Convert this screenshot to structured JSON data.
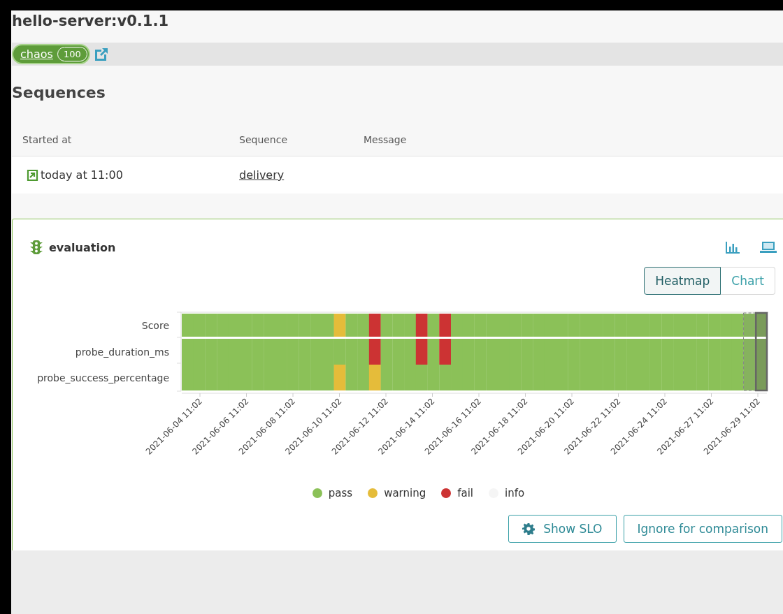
{
  "title": "hello-server:v0.1.1",
  "stage_badge": {
    "label": "chaos",
    "count": "100"
  },
  "sequences": {
    "heading": "Sequences",
    "columns": [
      "Started at",
      "Sequence",
      "Message"
    ],
    "rows": [
      {
        "started": "today at 11:00",
        "sequence": "delivery"
      }
    ]
  },
  "evaluation": {
    "title": "evaluation",
    "view_toggle": [
      {
        "label": "Heatmap",
        "selected": true
      },
      {
        "label": "Chart",
        "selected": false
      }
    ],
    "heatmap": {
      "rows": [
        "Score",
        "probe_duration_ms",
        "probe_success_percentage"
      ],
      "xticks": [
        "2021-06-04 11:02",
        "2021-06-06 11:02",
        "2021-06-08 11:02",
        "2021-06-10 11:02",
        "2021-06-12 11:02",
        "2021-06-14 11:02",
        "2021-06-16 11:02",
        "2021-06-18 11:02",
        "2021-06-20 11:02",
        "2021-06-22 11:02",
        "2021-06-24 11:02",
        "2021-06-27 11:02",
        "2021-06-29 11:02"
      ],
      "columns": [
        {
          "cells": [
            {
              "color": "#8bc158"
            },
            {
              "color": "#8bc158"
            },
            {
              "color": "#8bc158"
            }
          ],
          "selected": false,
          "compared": false
        },
        {
          "cells": [
            {
              "color": "#8bc158"
            },
            {
              "color": "#8bc158"
            },
            {
              "color": "#8bc158"
            }
          ],
          "selected": false,
          "compared": false
        },
        {
          "cells": [
            {
              "color": "#8bc158"
            },
            {
              "color": "#8bc158"
            },
            {
              "color": "#8bc158"
            }
          ],
          "selected": false,
          "compared": false
        },
        {
          "cells": [
            {
              "color": "#8bc158"
            },
            {
              "color": "#8bc158"
            },
            {
              "color": "#8bc158"
            }
          ],
          "selected": false,
          "compared": false
        },
        {
          "cells": [
            {
              "color": "#8bc158"
            },
            {
              "color": "#8bc158"
            },
            {
              "color": "#8bc158"
            }
          ],
          "selected": false,
          "compared": false
        },
        {
          "cells": [
            {
              "color": "#8bc158"
            },
            {
              "color": "#8bc158"
            },
            {
              "color": "#8bc158"
            }
          ],
          "selected": false,
          "compared": false
        },
        {
          "cells": [
            {
              "color": "#8bc158"
            },
            {
              "color": "#8bc158"
            },
            {
              "color": "#8bc158"
            }
          ],
          "selected": false,
          "compared": false
        },
        {
          "cells": [
            {
              "color": "#8bc158"
            },
            {
              "color": "#8bc158"
            },
            {
              "color": "#8bc158"
            }
          ],
          "selected": false,
          "compared": false
        },
        {
          "cells": [
            {
              "color": "#8bc158"
            },
            {
              "color": "#8bc158"
            },
            {
              "color": "#8bc158"
            }
          ],
          "selected": false,
          "compared": false
        },
        {
          "cells": [
            {
              "color": "#8bc158"
            },
            {
              "color": "#8bc158"
            },
            {
              "color": "#8bc158"
            }
          ],
          "selected": false,
          "compared": false
        },
        {
          "cells": [
            {
              "color": "#8bc158"
            },
            {
              "color": "#8bc158"
            },
            {
              "color": "#8bc158"
            }
          ],
          "selected": false,
          "compared": false
        },
        {
          "cells": [
            {
              "color": "#8bc158"
            },
            {
              "color": "#8bc158"
            },
            {
              "color": "#8bc158"
            }
          ],
          "selected": false,
          "compared": false
        },
        {
          "cells": [
            {
              "color": "#8bc158"
            },
            {
              "color": "#8bc158"
            },
            {
              "color": "#8bc158"
            }
          ],
          "selected": false,
          "compared": false
        },
        {
          "cells": [
            {
              "color": "#e5bc3a"
            },
            {
              "color": "#8bc158"
            },
            {
              "color": "#e5bc3a"
            }
          ],
          "selected": false,
          "compared": false
        },
        {
          "cells": [
            {
              "color": "#8bc158"
            },
            {
              "color": "#8bc158"
            },
            {
              "color": "#8bc158"
            }
          ],
          "selected": false,
          "compared": false
        },
        {
          "cells": [
            {
              "color": "#8bc158"
            },
            {
              "color": "#8bc158"
            },
            {
              "color": "#8bc158"
            }
          ],
          "selected": false,
          "compared": false
        },
        {
          "cells": [
            {
              "color": "#cc3333"
            },
            {
              "color": "#cc3333"
            },
            {
              "color": "#e5bc3a"
            }
          ],
          "selected": false,
          "compared": false
        },
        {
          "cells": [
            {
              "color": "#8bc158"
            },
            {
              "color": "#8bc158"
            },
            {
              "color": "#8bc158"
            }
          ],
          "selected": false,
          "compared": false
        },
        {
          "cells": [
            {
              "color": "#8bc158"
            },
            {
              "color": "#8bc158"
            },
            {
              "color": "#8bc158"
            }
          ],
          "selected": false,
          "compared": false
        },
        {
          "cells": [
            {
              "color": "#8bc158"
            },
            {
              "color": "#8bc158"
            },
            {
              "color": "#8bc158"
            }
          ],
          "selected": false,
          "compared": false
        },
        {
          "cells": [
            {
              "color": "#cc3333"
            },
            {
              "color": "#cc3333"
            },
            {
              "color": "#8bc158"
            }
          ],
          "selected": false,
          "compared": false
        },
        {
          "cells": [
            {
              "color": "#8bc158"
            },
            {
              "color": "#8bc158"
            },
            {
              "color": "#8bc158"
            }
          ],
          "selected": false,
          "compared": false
        },
        {
          "cells": [
            {
              "color": "#cc3333"
            },
            {
              "color": "#cc3333"
            },
            {
              "color": "#8bc158"
            }
          ],
          "selected": false,
          "compared": false
        },
        {
          "cells": [
            {
              "color": "#8bc158"
            },
            {
              "color": "#8bc158"
            },
            {
              "color": "#8bc158"
            }
          ],
          "selected": false,
          "compared": false
        },
        {
          "cells": [
            {
              "color": "#8bc158"
            },
            {
              "color": "#8bc158"
            },
            {
              "color": "#8bc158"
            }
          ],
          "selected": false,
          "compared": false
        },
        {
          "cells": [
            {
              "color": "#8bc158"
            },
            {
              "color": "#8bc158"
            },
            {
              "color": "#8bc158"
            }
          ],
          "selected": false,
          "compared": false
        },
        {
          "cells": [
            {
              "color": "#8bc158"
            },
            {
              "color": "#8bc158"
            },
            {
              "color": "#8bc158"
            }
          ],
          "selected": false,
          "compared": false
        },
        {
          "cells": [
            {
              "color": "#8bc158"
            },
            {
              "color": "#8bc158"
            },
            {
              "color": "#8bc158"
            }
          ],
          "selected": false,
          "compared": false
        },
        {
          "cells": [
            {
              "color": "#8bc158"
            },
            {
              "color": "#8bc158"
            },
            {
              "color": "#8bc158"
            }
          ],
          "selected": false,
          "compared": false
        },
        {
          "cells": [
            {
              "color": "#8bc158"
            },
            {
              "color": "#8bc158"
            },
            {
              "color": "#8bc158"
            }
          ],
          "selected": false,
          "compared": false
        },
        {
          "cells": [
            {
              "color": "#8bc158"
            },
            {
              "color": "#8bc158"
            },
            {
              "color": "#8bc158"
            }
          ],
          "selected": false,
          "compared": false
        },
        {
          "cells": [
            {
              "color": "#8bc158"
            },
            {
              "color": "#8bc158"
            },
            {
              "color": "#8bc158"
            }
          ],
          "selected": false,
          "compared": false
        },
        {
          "cells": [
            {
              "color": "#8bc158"
            },
            {
              "color": "#8bc158"
            },
            {
              "color": "#8bc158"
            }
          ],
          "selected": false,
          "compared": false
        },
        {
          "cells": [
            {
              "color": "#8bc158"
            },
            {
              "color": "#8bc158"
            },
            {
              "color": "#8bc158"
            }
          ],
          "selected": false,
          "compared": false
        },
        {
          "cells": [
            {
              "color": "#8bc158"
            },
            {
              "color": "#8bc158"
            },
            {
              "color": "#8bc158"
            }
          ],
          "selected": false,
          "compared": false
        },
        {
          "cells": [
            {
              "color": "#8bc158"
            },
            {
              "color": "#8bc158"
            },
            {
              "color": "#8bc158"
            }
          ],
          "selected": false,
          "compared": false
        },
        {
          "cells": [
            {
              "color": "#8bc158"
            },
            {
              "color": "#8bc158"
            },
            {
              "color": "#8bc158"
            }
          ],
          "selected": false,
          "compared": false
        },
        {
          "cells": [
            {
              "color": "#8bc158"
            },
            {
              "color": "#8bc158"
            },
            {
              "color": "#8bc158"
            }
          ],
          "selected": false,
          "compared": false
        },
        {
          "cells": [
            {
              "color": "#8bc158"
            },
            {
              "color": "#8bc158"
            },
            {
              "color": "#8bc158"
            }
          ],
          "selected": false,
          "compared": false
        },
        {
          "cells": [
            {
              "color": "#8bc158"
            },
            {
              "color": "#8bc158"
            },
            {
              "color": "#8bc158"
            }
          ],
          "selected": false,
          "compared": false
        },
        {
          "cells": [
            {
              "color": "#8bc158"
            },
            {
              "color": "#8bc158"
            },
            {
              "color": "#8bc158"
            }
          ],
          "selected": false,
          "compared": false
        },
        {
          "cells": [
            {
              "color": "#8bc158"
            },
            {
              "color": "#8bc158"
            },
            {
              "color": "#8bc158"
            }
          ],
          "selected": false,
          "compared": false
        },
        {
          "cells": [
            {
              "color": "#8bc158"
            },
            {
              "color": "#8bc158"
            },
            {
              "color": "#8bc158"
            }
          ],
          "selected": false,
          "compared": false
        },
        {
          "cells": [
            {
              "color": "#8bc158"
            },
            {
              "color": "#8bc158"
            },
            {
              "color": "#8bc158"
            }
          ],
          "selected": false,
          "compared": false
        },
        {
          "cells": [
            {
              "color": "#8bc158"
            },
            {
              "color": "#8bc158"
            },
            {
              "color": "#8bc158"
            }
          ],
          "selected": false,
          "compared": false
        },
        {
          "cells": [
            {
              "color": "#8bc158"
            },
            {
              "color": "#8bc158"
            },
            {
              "color": "#8bc158"
            }
          ],
          "selected": false,
          "compared": false
        },
        {
          "cells": [
            {
              "color": "#8bc158"
            },
            {
              "color": "#8bc158"
            },
            {
              "color": "#8bc158"
            }
          ],
          "selected": false,
          "compared": false
        },
        {
          "cells": [
            {
              "color": "#8bc158"
            },
            {
              "color": "#8bc158"
            },
            {
              "color": "#8bc158"
            }
          ],
          "selected": false,
          "compared": false
        },
        {
          "cells": [
            {
              "color": "#86b25e"
            },
            {
              "color": "#86b25e"
            },
            {
              "color": "#86b25e"
            }
          ],
          "selected": false,
          "compared": true
        },
        {
          "cells": [
            {
              "color": "#7a9b5a"
            },
            {
              "color": "#7a9b5a"
            },
            {
              "color": "#7a9b5a"
            }
          ],
          "selected": true,
          "compared": false
        }
      ]
    },
    "legend": [
      {
        "label": "pass",
        "color": "#8bc158"
      },
      {
        "label": "warning",
        "color": "#e5bc3a"
      },
      {
        "label": "fail",
        "color": "#cc3333"
      },
      {
        "label": "info",
        "color": "#f5f5f5"
      }
    ],
    "buttons": [
      "Show SLO",
      "Ignore for comparison"
    ]
  }
}
